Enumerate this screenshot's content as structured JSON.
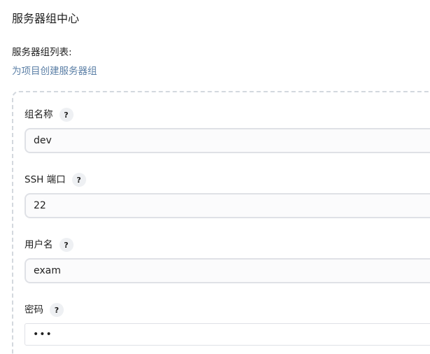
{
  "page": {
    "title": "服务器组中心",
    "list_label": "服务器组列表:",
    "create_link": "为项目创建服务器组"
  },
  "form": {
    "group_name": {
      "label": "组名称",
      "help": "?",
      "value": "dev"
    },
    "ssh_port": {
      "label": "SSH 端口",
      "help": "?",
      "value": "22"
    },
    "username": {
      "label": "用户名",
      "help": "?",
      "value": "exam"
    },
    "password": {
      "label": "密码",
      "help": "?",
      "value": "•••"
    }
  },
  "colors": {
    "link": "#5b7fa6",
    "dashed_border": "#d3d8de",
    "input_border": "#dfe1e6",
    "help_bg": "#eef0f3"
  }
}
